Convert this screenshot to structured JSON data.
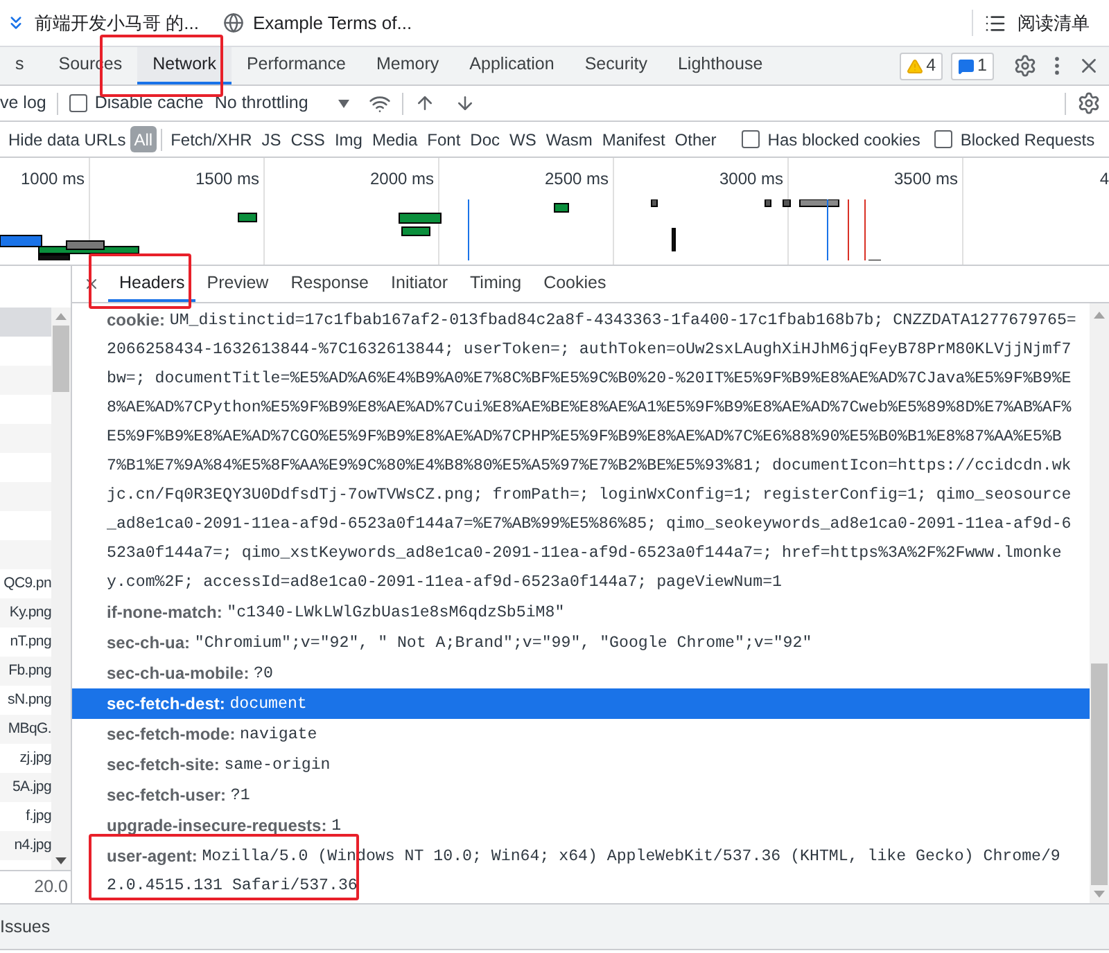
{
  "bookmarks": [
    {
      "kind": "folder",
      "label": "前端开发小马哥 的..."
    },
    {
      "kind": "site",
      "label": "Example Terms of..."
    }
  ],
  "reading_list": "阅读清单",
  "devtools_tabs": [
    {
      "label": "s",
      "selected": false
    },
    {
      "label": "Sources",
      "selected": false
    },
    {
      "label": "Network",
      "selected": true
    },
    {
      "label": "Performance",
      "selected": false
    },
    {
      "label": "Memory",
      "selected": false
    },
    {
      "label": "Application",
      "selected": false
    },
    {
      "label": "Security",
      "selected": false
    },
    {
      "label": "Lighthouse",
      "selected": false
    }
  ],
  "warnings_count": "4",
  "messages_count": "1",
  "toolbar": {
    "preserve_log": {
      "label": "ve log"
    },
    "disable_cache": {
      "label": "Disable cache",
      "checked": false
    },
    "throttling": "No throttling"
  },
  "filter_bar": {
    "hide_data_urls": "Hide data URLs",
    "types": [
      {
        "label": "All",
        "selected": true
      },
      {
        "label": "Fetch/XHR",
        "selected": false
      },
      {
        "label": "JS",
        "selected": false
      },
      {
        "label": "CSS",
        "selected": false
      },
      {
        "label": "Img",
        "selected": false
      },
      {
        "label": "Media",
        "selected": false
      },
      {
        "label": "Font",
        "selected": false
      },
      {
        "label": "Doc",
        "selected": false
      },
      {
        "label": "WS",
        "selected": false
      },
      {
        "label": "Wasm",
        "selected": false
      },
      {
        "label": "Manifest",
        "selected": false
      },
      {
        "label": "Other",
        "selected": false
      }
    ],
    "has_blocked_cookies": {
      "label": "Has blocked cookies",
      "checked": false
    },
    "blocked_requests": {
      "label": "Blocked Requests",
      "checked": false
    }
  },
  "timeline_ticks": [
    "1000 ms",
    "1500 ms",
    "2000 ms",
    "2500 ms",
    "3000 ms",
    "3500 ms",
    "4"
  ],
  "request_list": [
    "QC9.pn",
    "Ky.png",
    "nT.png",
    "Fb.png",
    "sN.png",
    "MBqG.",
    "zj.jpg",
    "5A.jpg",
    "f.jpg",
    "n4.jpg"
  ],
  "status_bar": "20.0",
  "detail_tabs": [
    {
      "label": "Headers",
      "selected": true
    },
    {
      "label": "Preview",
      "selected": false
    },
    {
      "label": "Response",
      "selected": false
    },
    {
      "label": "Initiator",
      "selected": false
    },
    {
      "label": "Timing",
      "selected": false
    },
    {
      "label": "Cookies",
      "selected": false
    }
  ],
  "request_headers": [
    {
      "name": "cookie:",
      "value": "UM_distinctid=17c1fbab167af2-013fbad84c2a8f-4343363-1fa400-17c1fbab168b7b; CNZZDATA1277679765=2066258434-1632613844-%7C1632613844; userToken=; authToken=oUw2sxLAughXiHJhM6jqFeyB78PrM80KLVjjNjmf7bw=; documentTitle=%E5%AD%A6%E4%B9%A0%E7%8C%BF%E5%9C%B0%20-%20IT%E5%9F%B9%E8%AE%AD%7CJava%E5%9F%B9%E8%AE%AD%7CPython%E5%9F%B9%E8%AE%AD%7Cui%E8%AE%BE%E8%AE%A1%E5%9F%B9%E8%AE%AD%7Cweb%E5%89%8D%E7%AB%AF%E5%9F%B9%E8%AE%AD%7CGO%E5%9F%B9%E8%AE%AD%7CPHP%E5%9F%B9%E8%AE%AD%7C%E6%88%90%E5%B0%B1%E8%87%AA%E5%B7%B1%E7%9A%84%E5%8F%AA%E9%9C%80%E4%B8%80%E5%A5%97%E7%B2%BE%E5%93%81; documentIcon=https://ccidcdn.wkjc.cn/Fq0R3EQY3U0DdfsdTj-7owTVWsCZ.png; fromPath=; loginWxConfig=1; registerConfig=1; qimo_seosource_ad8e1ca0-2091-11ea-af9d-6523a0f144a7=%E7%AB%99%E5%86%85; qimo_seokeywords_ad8e1ca0-2091-11ea-af9d-6523a0f144a7=; qimo_xstKeywords_ad8e1ca0-2091-11ea-af9d-6523a0f144a7=; href=https%3A%2F%2Fwww.lmonkey.com%2F; accessId=ad8e1ca0-2091-11ea-af9d-6523a0f144a7; pageViewNum=1",
      "selected": false
    },
    {
      "name": "if-none-match:",
      "value": "\"c1340-LWkLWlGzbUas1e8sM6qdzSb5iM8\"",
      "selected": false
    },
    {
      "name": "sec-ch-ua:",
      "value": "\"Chromium\";v=\"92\", \" Not A;Brand\";v=\"99\", \"Google Chrome\";v=\"92\"",
      "selected": false
    },
    {
      "name": "sec-ch-ua-mobile:",
      "value": "?0",
      "selected": false
    },
    {
      "name": "sec-fetch-dest:",
      "value": "document",
      "selected": true
    },
    {
      "name": "sec-fetch-mode:",
      "value": "navigate",
      "selected": false
    },
    {
      "name": "sec-fetch-site:",
      "value": "same-origin",
      "selected": false
    },
    {
      "name": "sec-fetch-user:",
      "value": "?1",
      "selected": false
    },
    {
      "name": "upgrade-insecure-requests:",
      "value": "1",
      "selected": false
    },
    {
      "name": "user-agent:",
      "value": "Mozilla/5.0 (Windows NT 10.0; Win64; x64) AppleWebKit/537.36 (KHTML, like Gecko) Chrome/92.0.4515.131 Safari/537.36",
      "selected": false
    }
  ],
  "drawer_tab": "Issues"
}
